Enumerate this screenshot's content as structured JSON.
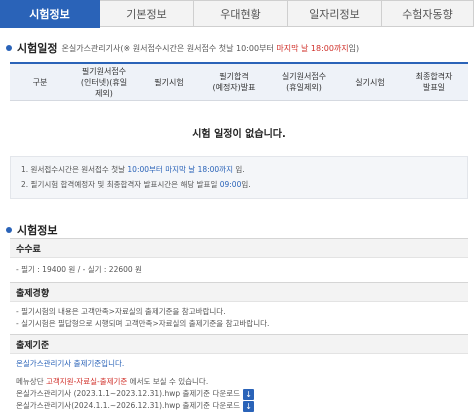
{
  "tabs": [
    "시험정보",
    "기본정보",
    "우대현황",
    "일자리정보",
    "수험자동향"
  ],
  "schedule": {
    "title": "시험일정",
    "subtitle_prefix": "온실가스관리기사(※ 원서접수시간은 원서접수 첫날 10:00부터 ",
    "subtitle_highlight": "마지막 날 18:00까지",
    "subtitle_suffix": "임)",
    "headers": [
      "구분",
      "필기원서접수\n(인터넷)(휴일\n제외)",
      "필기시험",
      "필기합격\n(예정자)발표",
      "실기원서접수\n(휴일제외)",
      "실기시험",
      "최종합격자\n발표일"
    ],
    "empty_message": "시험 일정이 없습니다.",
    "notes": {
      "note1_a": "1. 원서접수시간은 원서접수 첫날 ",
      "note1_b": "10:00부터 마지막 날 18:00까지",
      "note1_c": " 임.",
      "note2_a": "2. 필기시험 합격예정자 및 최종합격자 발표시간은 해당 발표일 ",
      "note2_b": "09:00",
      "note2_c": "임."
    }
  },
  "exam_info": {
    "title": "시험정보",
    "fee": {
      "label": "수수료",
      "text": "- 필기 : 19400 원 / - 실기 : 22600 원"
    },
    "trend": {
      "label": "출제경향",
      "line1": "- 필기시험의 내용은 고객만족>자료실의 출제기준을 참고바랍니다.",
      "line2": "- 실기시험은 필답형으로 시행되며 고객만족>자료실의 출제기준을 참고바랍니다."
    },
    "criteria": {
      "label": "출제기준",
      "link": "온실가스관리기사 출제기준입니다.",
      "menu_prefix": "메뉴상단 ",
      "menu_link": "고객지원-자료실-출제기준",
      "menu_suffix": " 에서도 보실 수 있습니다.",
      "file1": "온실가스관리기사 (2023.1.1~2023.12.31).hwp 출제기준 다운로드",
      "file2": "온실가스관리기사(2024.1.1.~2026.12.31).hwp 출제기준 다운로드"
    }
  }
}
